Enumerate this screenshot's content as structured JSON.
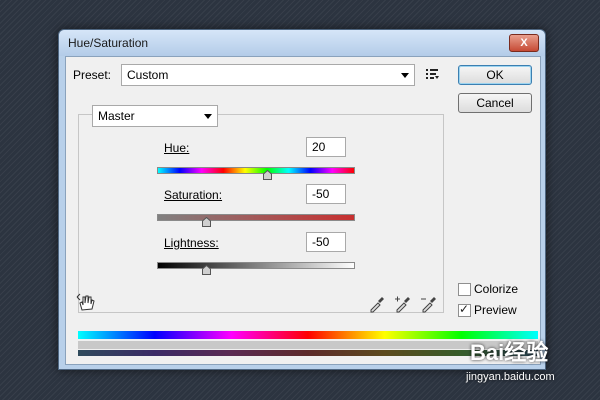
{
  "window": {
    "title": "Hue/Saturation",
    "close_glyph": "X"
  },
  "preset": {
    "label": "Preset:",
    "value": "Custom"
  },
  "buttons": {
    "ok": "OK",
    "cancel": "Cancel"
  },
  "channel": {
    "value": "Master"
  },
  "sliders": [
    {
      "label": "Hue:",
      "value": "20",
      "level_fraction": 0.56
    },
    {
      "label": "Saturation:",
      "value": "-50",
      "level_fraction": 0.25
    },
    {
      "label": "Lightness:",
      "value": "-50",
      "level_fraction": 0.25
    }
  ],
  "options": {
    "colorize": {
      "label": "Colorize",
      "checked": false
    },
    "preview": {
      "label": "Preview",
      "checked": true
    }
  },
  "icons": [
    "close-icon",
    "preset-options-icon",
    "targeted-adjustment-hand-icon",
    "eyedropper-icon",
    "eyedropper-plus-icon",
    "eyedropper-minus-icon"
  ],
  "watermark": {
    "brand": "Bai",
    "brand2": "经验",
    "url": "jingyan.baidu.com"
  },
  "colors": {
    "window_frame": "#b8d0ea",
    "dialog_bg": "#f0f0f0",
    "background": "#2c3440"
  }
}
